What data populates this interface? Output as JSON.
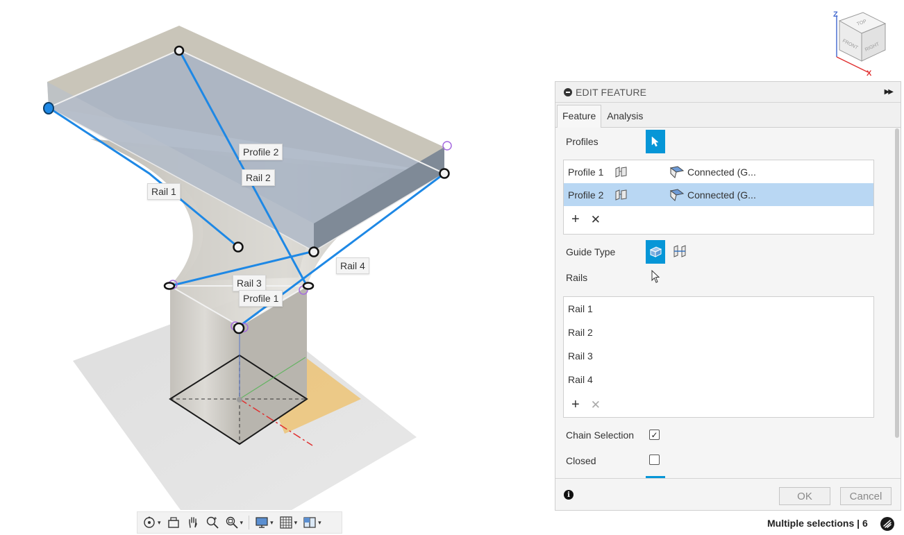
{
  "viewport": {
    "callouts": {
      "rail1": "Rail 1",
      "rail2": "Rail 2",
      "rail3": "Rail 3",
      "rail4": "Rail 4",
      "profile1": "Profile 1",
      "profile2": "Profile 2"
    },
    "viewcube": {
      "top": "TOP",
      "front": "FRONT",
      "right": "RIGHT",
      "axis_z": "Z",
      "axis_x": "X"
    }
  },
  "toolbar": {
    "items": [
      "orbit-icon",
      "look-at-icon",
      "pan-icon",
      "zoom-icon",
      "fit-icon",
      "display-settings-icon",
      "grid-icon",
      "viewports-icon"
    ]
  },
  "dialog": {
    "title": "EDIT FEATURE",
    "tabs": [
      {
        "label": "Feature",
        "active": true
      },
      {
        "label": "Analysis",
        "active": false
      }
    ],
    "profiles_label": "Profiles",
    "profiles": [
      {
        "name": "Profile 1",
        "continuity": "Connected (G...",
        "selected": false
      },
      {
        "name": "Profile 2",
        "continuity": "Connected (G...",
        "selected": true
      }
    ],
    "guide_type_label": "Guide Type",
    "rails_label": "Rails",
    "rails": [
      "Rail 1",
      "Rail 2",
      "Rail 3",
      "Rail 4"
    ],
    "chain_selection_label": "Chain Selection",
    "chain_selection_checked": true,
    "closed_label": "Closed",
    "closed_checked": false,
    "ok_label": "OK",
    "cancel_label": "Cancel"
  },
  "status": {
    "text": "Multiple selections | 6"
  },
  "colors": {
    "accent": "#0696d7",
    "selected_row": "#b9d7f3",
    "rail_line": "#1e88e5",
    "plane_orange": "#f2b23a"
  }
}
